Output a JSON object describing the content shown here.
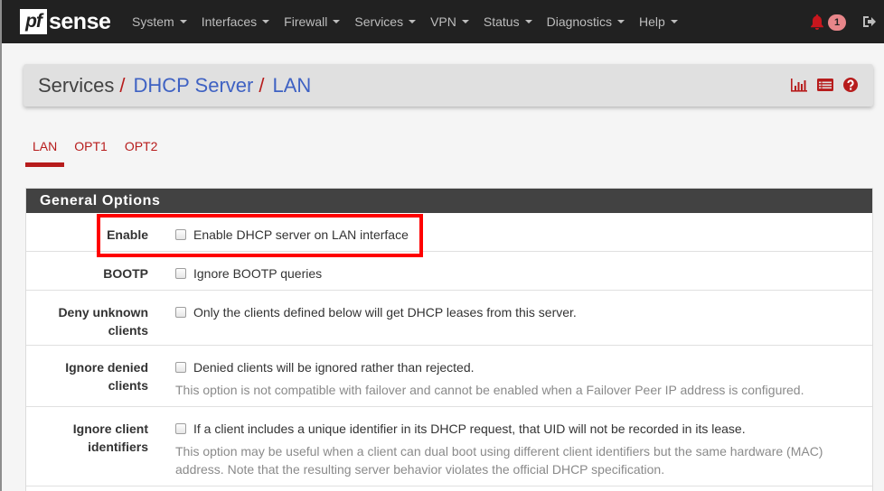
{
  "navbar": {
    "brand_pf": "pf",
    "brand_sense": "sense",
    "menu": [
      {
        "label": "System"
      },
      {
        "label": "Interfaces"
      },
      {
        "label": "Firewall"
      },
      {
        "label": "Services"
      },
      {
        "label": "VPN"
      },
      {
        "label": "Status"
      },
      {
        "label": "Diagnostics"
      },
      {
        "label": "Help"
      }
    ],
    "notification_icon": "bell-icon",
    "notification_count": "1",
    "logout_icon": "sign-out-icon"
  },
  "header": {
    "breadcrumb": [
      {
        "label": "Services"
      },
      {
        "label": "DHCP Server"
      },
      {
        "label": "LAN"
      }
    ],
    "separator": "/",
    "icons": [
      "bar-chart-icon",
      "list-log-icon",
      "help-icon"
    ]
  },
  "tabs": [
    {
      "label": "LAN",
      "active": true
    },
    {
      "label": "OPT1",
      "active": false
    },
    {
      "label": "OPT2",
      "active": false
    }
  ],
  "panel": {
    "title": "General Options",
    "rows": [
      {
        "label": "Enable",
        "option": "Enable DHCP server on LAN interface",
        "checked": false,
        "help": ""
      },
      {
        "label": "BOOTP",
        "option": "Ignore BOOTP queries",
        "checked": false,
        "help": ""
      },
      {
        "label": "Deny unknown clients",
        "option": "Only the clients defined below will get DHCP leases from this server.",
        "checked": false,
        "help": ""
      },
      {
        "label": "Ignore denied clients",
        "option": "Denied clients will be ignored rather than rejected.",
        "checked": false,
        "help": "This option is not compatible with failover and cannot be enabled when a Failover Peer IP address is configured."
      },
      {
        "label": "Ignore client identifiers",
        "option": "If a client includes a unique identifier in its DHCP request, that UID will not be recorded in its lease.",
        "checked": false,
        "help": "This option may be useful when a client can dual boot using different client identifiers but the same hardware (MAC) address. Note that the resulting server behavior violates the official DHCP specification."
      }
    ]
  },
  "colors": {
    "accent": "#b71c1c",
    "navbar_bg": "#212121",
    "link": "#3f62c3",
    "highlight_box": "#ff0000"
  }
}
